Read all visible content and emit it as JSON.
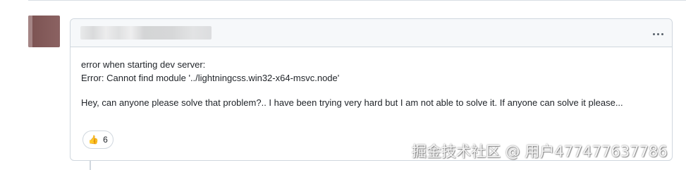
{
  "comment": {
    "author": "",
    "more_icon": "kebab-horizontal-icon",
    "lines": [
      "error when starting dev server:",
      "Error: Cannot find module '../lightningcss.win32-x64-msvc.node'",
      "Hey, can anyone please solve that problem?.. I have been trying very hard but I am not able to solve it. If anyone can solve it please..."
    ],
    "reaction": {
      "emoji": "👍",
      "emoji_name": "thumbs-up-icon",
      "count": "6"
    }
  },
  "watermark": {
    "text": "掘金技术社区 @ 用户477477637786"
  },
  "colors": {
    "border": "#d0d7de",
    "header_bg": "#f6f8fa",
    "text": "#1f2328"
  }
}
